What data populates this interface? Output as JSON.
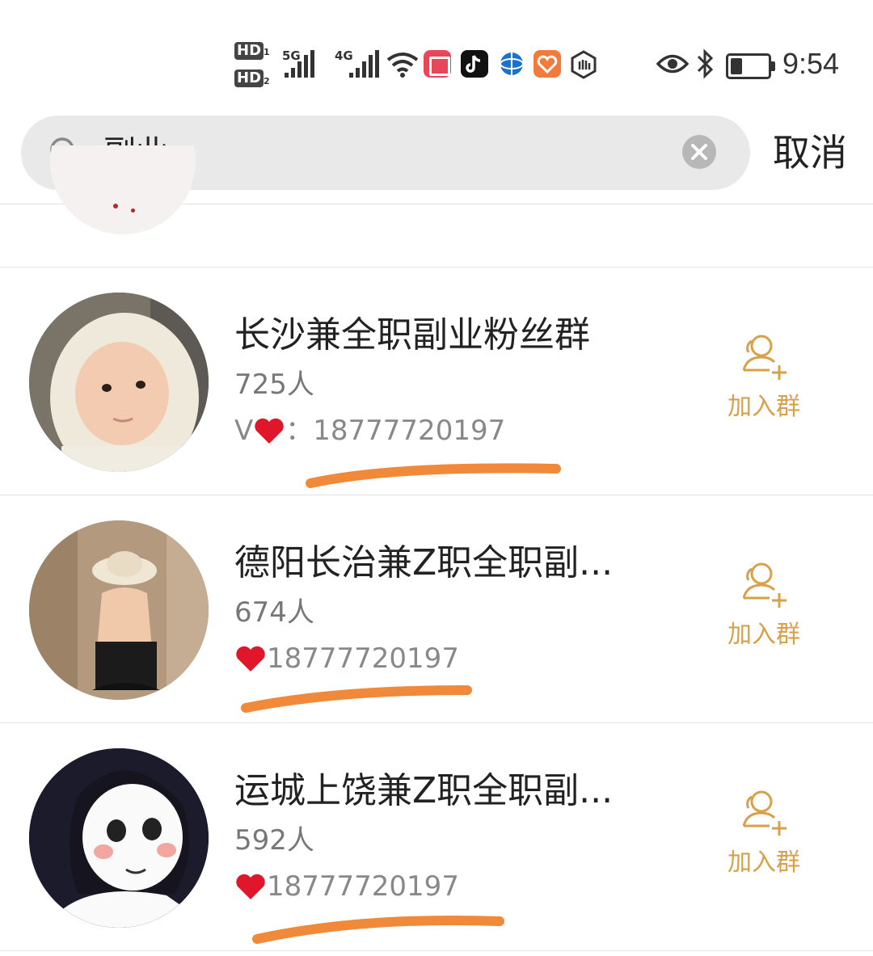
{
  "status_bar": {
    "hd1": "HD",
    "hd1_sub": "1",
    "hd2": "HD",
    "hd2_sub": "2",
    "net1": "5G",
    "net2": "4G",
    "time": "9:54",
    "icons": [
      "hd-icon",
      "signal-icon",
      "wifi-icon",
      "book-app-icon",
      "tiktok-icon",
      "browser-icon",
      "health-app-icon",
      "hand-app-icon",
      "eye-icon",
      "bluetooth-icon",
      "battery-icon"
    ]
  },
  "search": {
    "query": "副业",
    "cancel_label": "取消"
  },
  "groups": [
    {
      "name": "长沙兼全职副业粉丝群",
      "count": "725人",
      "contact_prefix": "V",
      "contact_sep": "：",
      "contact_number": "18777720197",
      "join_label": "加入群"
    },
    {
      "name": "德阳长治兼Z职全职副...",
      "count": "674人",
      "contact_number": "18777720197",
      "join_label": "加入群"
    },
    {
      "name": "运城上饶兼Z职全职副...",
      "count": "592人",
      "contact_number": "18777720197",
      "join_label": "加入群"
    }
  ],
  "colors": {
    "accent_orange": "#d9a04a",
    "underline_orange": "#f0893a",
    "heart_red": "#e0162b"
  }
}
